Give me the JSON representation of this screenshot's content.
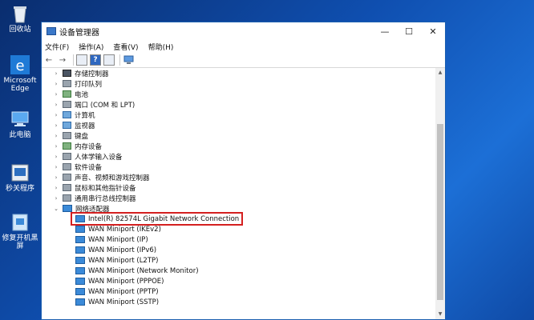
{
  "desktop": {
    "icons": [
      {
        "label": "回收站",
        "icon": "recycle-bin-icon"
      },
      {
        "label": "Microsoft Edge",
        "icon": "edge-icon"
      },
      {
        "label": "此电脑",
        "icon": "computer-icon"
      },
      {
        "label": "秒关程序",
        "icon": "app-icon"
      },
      {
        "label": "修复开机黑屏",
        "icon": "repair-icon"
      }
    ]
  },
  "window": {
    "title": "设备管理器",
    "controls": {
      "minimize": "—",
      "maximize": "☐",
      "close": "✕"
    }
  },
  "menu": [
    "文件(F)",
    "操作(A)",
    "查看(V)",
    "帮助(H)"
  ],
  "toolbar": {
    "back": "←",
    "forward": "→",
    "help": "?"
  },
  "tree": {
    "categories": [
      {
        "label": "存储控制器",
        "arrow": "›"
      },
      {
        "label": "打印队列",
        "arrow": "›"
      },
      {
        "label": "电池",
        "arrow": "›"
      },
      {
        "label": "端口 (COM 和 LPT)",
        "arrow": "›"
      },
      {
        "label": "计算机",
        "arrow": "›"
      },
      {
        "label": "监视器",
        "arrow": "›"
      },
      {
        "label": "键盘",
        "arrow": "›"
      },
      {
        "label": "内存设备",
        "arrow": "›"
      },
      {
        "label": "人体学输入设备",
        "arrow": "›"
      },
      {
        "label": "软件设备",
        "arrow": "›"
      },
      {
        "label": "声音、视频和游戏控制器",
        "arrow": "›"
      },
      {
        "label": "鼠标和其他指针设备",
        "arrow": "›"
      },
      {
        "label": "通用串行总线控制器",
        "arrow": "›"
      },
      {
        "label": "网络适配器",
        "arrow": "⌄"
      }
    ],
    "network_children": [
      "Intel(R) 82574L Gigabit Network Connection",
      "WAN Miniport (IKEv2)",
      "WAN Miniport (IP)",
      "WAN Miniport (IPv6)",
      "WAN Miniport (L2TP)",
      "WAN Miniport (Network Monitor)",
      "WAN Miniport (PPPOE)",
      "WAN Miniport (PPTP)",
      "WAN Miniport (SSTP)"
    ]
  }
}
